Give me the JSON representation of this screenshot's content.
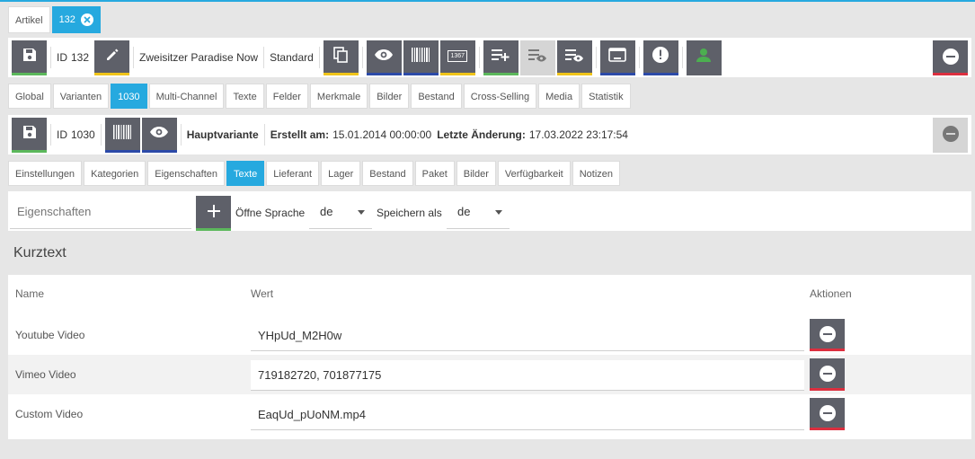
{
  "outer_tabs": [
    {
      "label": "Artikel",
      "active": false
    },
    {
      "label": "132",
      "active": true
    }
  ],
  "item_toolbar": {
    "id_label": "ID",
    "id_value": "132",
    "name": "Zweisitzer Paradise Now",
    "type": "Standard"
  },
  "item_tabs": [
    {
      "label": "Global",
      "active": false
    },
    {
      "label": "Varianten",
      "active": false
    },
    {
      "label": "1030",
      "active": true
    },
    {
      "label": "Multi-Channel",
      "active": false
    },
    {
      "label": "Texte",
      "active": false
    },
    {
      "label": "Felder",
      "active": false
    },
    {
      "label": "Merkmale",
      "active": false
    },
    {
      "label": "Bilder",
      "active": false
    },
    {
      "label": "Bestand",
      "active": false
    },
    {
      "label": "Cross-Selling",
      "active": false
    },
    {
      "label": "Media",
      "active": false
    },
    {
      "label": "Statistik",
      "active": false
    }
  ],
  "variant_toolbar": {
    "id_label": "ID",
    "id_value": "1030",
    "main_variant": "Hauptvariante",
    "created_label": "Erstellt am:",
    "created_value": "15.01.2014 00:00:00",
    "changed_label": "Letzte Änderung:",
    "changed_value": "17.03.2022 23:17:54"
  },
  "variant_tabs": [
    {
      "label": "Einstellungen",
      "active": false
    },
    {
      "label": "Kategorien",
      "active": false
    },
    {
      "label": "Eigenschaften",
      "active": false
    },
    {
      "label": "Texte",
      "active": true
    },
    {
      "label": "Lieferant",
      "active": false
    },
    {
      "label": "Lager",
      "active": false
    },
    {
      "label": "Bestand",
      "active": false
    },
    {
      "label": "Paket",
      "active": false
    },
    {
      "label": "Bilder",
      "active": false
    },
    {
      "label": "Verfügbarkeit",
      "active": false
    },
    {
      "label": "Notizen",
      "active": false
    }
  ],
  "filter": {
    "property_placeholder": "Eigenschaften",
    "open_language_label": "Öffne Sprache",
    "open_language_value": "de",
    "save_as_label": "Speichern als",
    "save_as_value": "de"
  },
  "section_title": "Kurztext",
  "table": {
    "headers": {
      "name": "Name",
      "value": "Wert",
      "actions": "Aktionen"
    },
    "rows": [
      {
        "name": "Youtube Video",
        "value": "YHpUd_M2H0w"
      },
      {
        "name": "Vimeo Video",
        "value": "719182720, 701877175"
      },
      {
        "name": "Custom Video",
        "value": "EaqUd_pUoNM.mp4"
      }
    ]
  },
  "colors": {
    "accent": "#26a9df",
    "button": "#5e6069",
    "green": "#5cb85c",
    "yellow": "#f0c419",
    "blue": "#2c4aa8",
    "red": "#dc2f3f"
  },
  "icons": {
    "barcode_number": "1367"
  }
}
